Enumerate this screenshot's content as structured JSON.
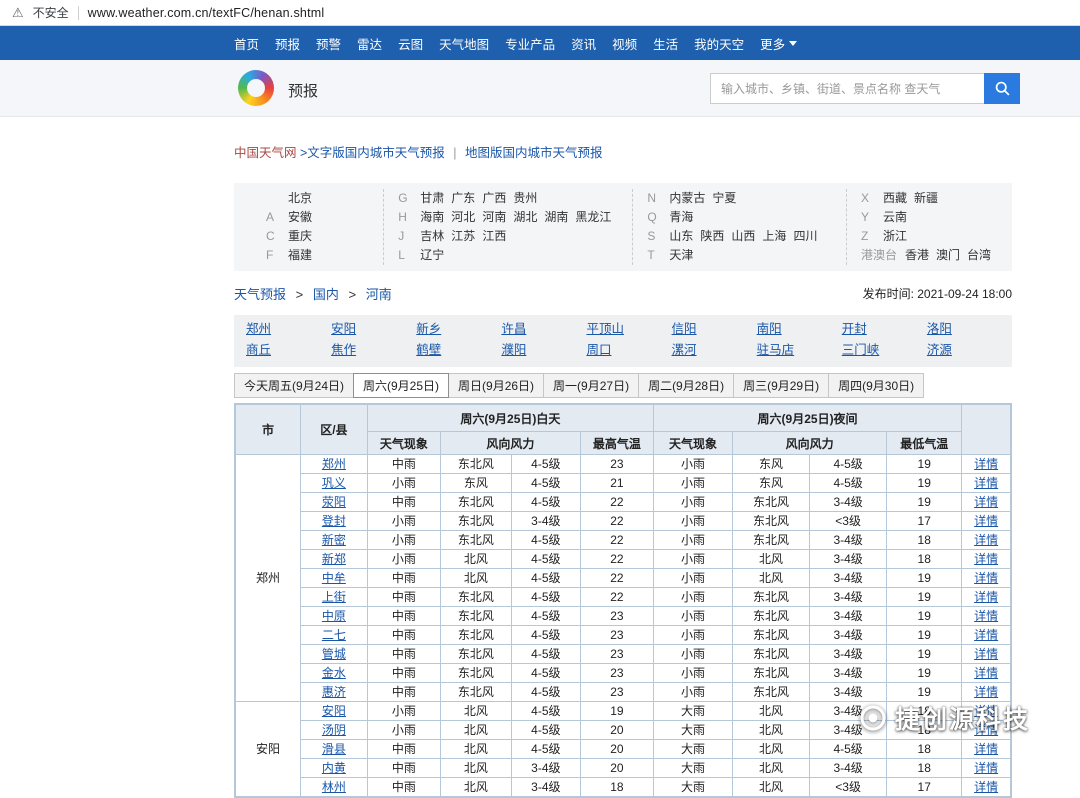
{
  "browser": {
    "security_warning": "不安全",
    "url": "www.weather.com.cn/textFC/henan.shtml"
  },
  "nav": {
    "items": [
      "首页",
      "预报",
      "预警",
      "雷达",
      "云图",
      "天气地图",
      "专业产品",
      "资讯",
      "视频",
      "生活",
      "我的天空"
    ],
    "more_label": "更多"
  },
  "header": {
    "section_title": "预报",
    "search_placeholder": "输入城市、乡镇、街道、景点名称 查天气"
  },
  "breadcrumb_top": {
    "site": "中国天气网",
    "text_version": ">文字版国内城市天气预报",
    "separator": "|",
    "map_version": "地图版国内城市天气预报"
  },
  "province_panel": {
    "columns": [
      {
        "groups": [
          {
            "letter": "",
            "items": [
              "北京"
            ]
          },
          {
            "letter": "A",
            "items": [
              "安徽"
            ]
          },
          {
            "letter": "C",
            "items": [
              "重庆"
            ]
          },
          {
            "letter": "F",
            "items": [
              "福建"
            ]
          }
        ]
      },
      {
        "groups": [
          {
            "letter": "G",
            "items": [
              "甘肃",
              "广东",
              "广西",
              "贵州"
            ]
          },
          {
            "letter": "H",
            "items": [
              "海南",
              "河北",
              "河南",
              "湖北",
              "湖南",
              "黑龙江"
            ]
          },
          {
            "letter": "J",
            "items": [
              "吉林",
              "江苏",
              "江西"
            ]
          },
          {
            "letter": "L",
            "items": [
              "辽宁"
            ]
          }
        ]
      },
      {
        "groups": [
          {
            "letter": "N",
            "items": [
              "内蒙古",
              "宁夏"
            ]
          },
          {
            "letter": "Q",
            "items": [
              "青海"
            ]
          },
          {
            "letter": "S",
            "items": [
              "山东",
              "陕西",
              "山西",
              "上海",
              "四川"
            ]
          },
          {
            "letter": "T",
            "items": [
              "天津"
            ]
          }
        ]
      },
      {
        "groups": [
          {
            "letter": "X",
            "items": [
              "西藏",
              "新疆"
            ]
          },
          {
            "letter": "Y",
            "items": [
              "云南"
            ]
          },
          {
            "letter": "Z",
            "items": [
              "浙江"
            ]
          },
          {
            "letter": "港澳台",
            "items": [
              "香港",
              "澳门",
              "台湾"
            ]
          }
        ]
      }
    ]
  },
  "page_breadcrumb": {
    "items": [
      "天气预报",
      "国内",
      "河南"
    ],
    "separator": ">",
    "publish_label": "发布时间:",
    "publish_time": "2021-09-24 18:00"
  },
  "city_links": {
    "rows": [
      [
        "郑州",
        "安阳",
        "新乡",
        "许昌",
        "平顶山",
        "信阳",
        "南阳",
        "开封",
        "洛阳"
      ],
      [
        "商丘",
        "焦作",
        "鹤壁",
        "濮阳",
        "周口",
        "漯河",
        "驻马店",
        "三门峡",
        "济源"
      ]
    ]
  },
  "date_tabs": [
    {
      "label": "今天周五(9月24日)",
      "active": false
    },
    {
      "label": "周六(9月25日)",
      "active": true
    },
    {
      "label": "周日(9月26日)",
      "active": false
    },
    {
      "label": "周一(9月27日)",
      "active": false
    },
    {
      "label": "周二(9月28日)",
      "active": false
    },
    {
      "label": "周三(9月29日)",
      "active": false
    },
    {
      "label": "周四(9月30日)",
      "active": false
    }
  ],
  "table": {
    "header": {
      "city": "市",
      "district": "区/县",
      "day_group": "周六(9月25日)白天",
      "night_group": "周六(9月25日)夜间",
      "phenomenon": "天气现象",
      "wind": "风向风力",
      "max_temp": "最高气温",
      "min_temp": "最低气温"
    },
    "detail_label": "详情",
    "groups": [
      {
        "city": "郑州",
        "rows": [
          {
            "district": "郑州",
            "day_weather": "中雨",
            "day_wind_dir": "东北风",
            "day_wind_level": "4-5级",
            "max_temp": "23",
            "night_weather": "小雨",
            "night_wind_dir": "东风",
            "night_wind_level": "4-5级",
            "min_temp": "19"
          },
          {
            "district": "巩义",
            "day_weather": "小雨",
            "day_wind_dir": "东风",
            "day_wind_level": "4-5级",
            "max_temp": "21",
            "night_weather": "小雨",
            "night_wind_dir": "东风",
            "night_wind_level": "4-5级",
            "min_temp": "19"
          },
          {
            "district": "荥阳",
            "day_weather": "中雨",
            "day_wind_dir": "东北风",
            "day_wind_level": "4-5级",
            "max_temp": "22",
            "night_weather": "小雨",
            "night_wind_dir": "东北风",
            "night_wind_level": "3-4级",
            "min_temp": "19"
          },
          {
            "district": "登封",
            "day_weather": "小雨",
            "day_wind_dir": "东北风",
            "day_wind_level": "3-4级",
            "max_temp": "22",
            "night_weather": "小雨",
            "night_wind_dir": "东北风",
            "night_wind_level": "<3级",
            "min_temp": "17"
          },
          {
            "district": "新密",
            "day_weather": "小雨",
            "day_wind_dir": "东北风",
            "day_wind_level": "4-5级",
            "max_temp": "22",
            "night_weather": "小雨",
            "night_wind_dir": "东北风",
            "night_wind_level": "3-4级",
            "min_temp": "18"
          },
          {
            "district": "新郑",
            "day_weather": "小雨",
            "day_wind_dir": "北风",
            "day_wind_level": "4-5级",
            "max_temp": "22",
            "night_weather": "小雨",
            "night_wind_dir": "北风",
            "night_wind_level": "3-4级",
            "min_temp": "18"
          },
          {
            "district": "中牟",
            "day_weather": "中雨",
            "day_wind_dir": "北风",
            "day_wind_level": "4-5级",
            "max_temp": "22",
            "night_weather": "小雨",
            "night_wind_dir": "北风",
            "night_wind_level": "3-4级",
            "min_temp": "19"
          },
          {
            "district": "上街",
            "day_weather": "中雨",
            "day_wind_dir": "东北风",
            "day_wind_level": "4-5级",
            "max_temp": "22",
            "night_weather": "小雨",
            "night_wind_dir": "东北风",
            "night_wind_level": "3-4级",
            "min_temp": "19"
          },
          {
            "district": "中原",
            "day_weather": "中雨",
            "day_wind_dir": "东北风",
            "day_wind_level": "4-5级",
            "max_temp": "23",
            "night_weather": "小雨",
            "night_wind_dir": "东北风",
            "night_wind_level": "3-4级",
            "min_temp": "19"
          },
          {
            "district": "二七",
            "day_weather": "中雨",
            "day_wind_dir": "东北风",
            "day_wind_level": "4-5级",
            "max_temp": "23",
            "night_weather": "小雨",
            "night_wind_dir": "东北风",
            "night_wind_level": "3-4级",
            "min_temp": "19"
          },
          {
            "district": "管城",
            "day_weather": "中雨",
            "day_wind_dir": "东北风",
            "day_wind_level": "4-5级",
            "max_temp": "23",
            "night_weather": "小雨",
            "night_wind_dir": "东北风",
            "night_wind_level": "3-4级",
            "min_temp": "19"
          },
          {
            "district": "金水",
            "day_weather": "中雨",
            "day_wind_dir": "东北风",
            "day_wind_level": "4-5级",
            "max_temp": "23",
            "night_weather": "小雨",
            "night_wind_dir": "东北风",
            "night_wind_level": "3-4级",
            "min_temp": "19"
          },
          {
            "district": "惠济",
            "day_weather": "中雨",
            "day_wind_dir": "东北风",
            "day_wind_level": "4-5级",
            "max_temp": "23",
            "night_weather": "小雨",
            "night_wind_dir": "东北风",
            "night_wind_level": "3-4级",
            "min_temp": "19"
          }
        ]
      },
      {
        "city": "安阳",
        "rows": [
          {
            "district": "安阳",
            "day_weather": "小雨",
            "day_wind_dir": "北风",
            "day_wind_level": "4-5级",
            "max_temp": "19",
            "night_weather": "大雨",
            "night_wind_dir": "北风",
            "night_wind_level": "3-4级",
            "min_temp": "18"
          },
          {
            "district": "汤阴",
            "day_weather": "小雨",
            "day_wind_dir": "北风",
            "day_wind_level": "4-5级",
            "max_temp": "20",
            "night_weather": "大雨",
            "night_wind_dir": "北风",
            "night_wind_level": "3-4级",
            "min_temp": "18"
          },
          {
            "district": "滑县",
            "day_weather": "中雨",
            "day_wind_dir": "北风",
            "day_wind_level": "4-5级",
            "max_temp": "20",
            "night_weather": "大雨",
            "night_wind_dir": "北风",
            "night_wind_level": "4-5级",
            "min_temp": "18"
          },
          {
            "district": "内黄",
            "day_weather": "中雨",
            "day_wind_dir": "北风",
            "day_wind_level": "3-4级",
            "max_temp": "20",
            "night_weather": "大雨",
            "night_wind_dir": "北风",
            "night_wind_level": "3-4级",
            "min_temp": "18"
          },
          {
            "district": "林州",
            "day_weather": "中雨",
            "day_wind_dir": "北风",
            "day_wind_level": "3-4级",
            "max_temp": "18",
            "night_weather": "大雨",
            "night_wind_dir": "北风",
            "night_wind_level": "<3级",
            "min_temp": "17"
          }
        ]
      }
    ]
  },
  "watermark": {
    "text": "捷创源科技"
  },
  "colors": {
    "nav_blue": "#1e5fae",
    "search_button_blue": "#2a7ae0",
    "link_blue": "#1a56a8",
    "site_name_red": "#aa4643",
    "table_border": "#b5c8da",
    "table_header_bg": "#e3eaf2"
  }
}
